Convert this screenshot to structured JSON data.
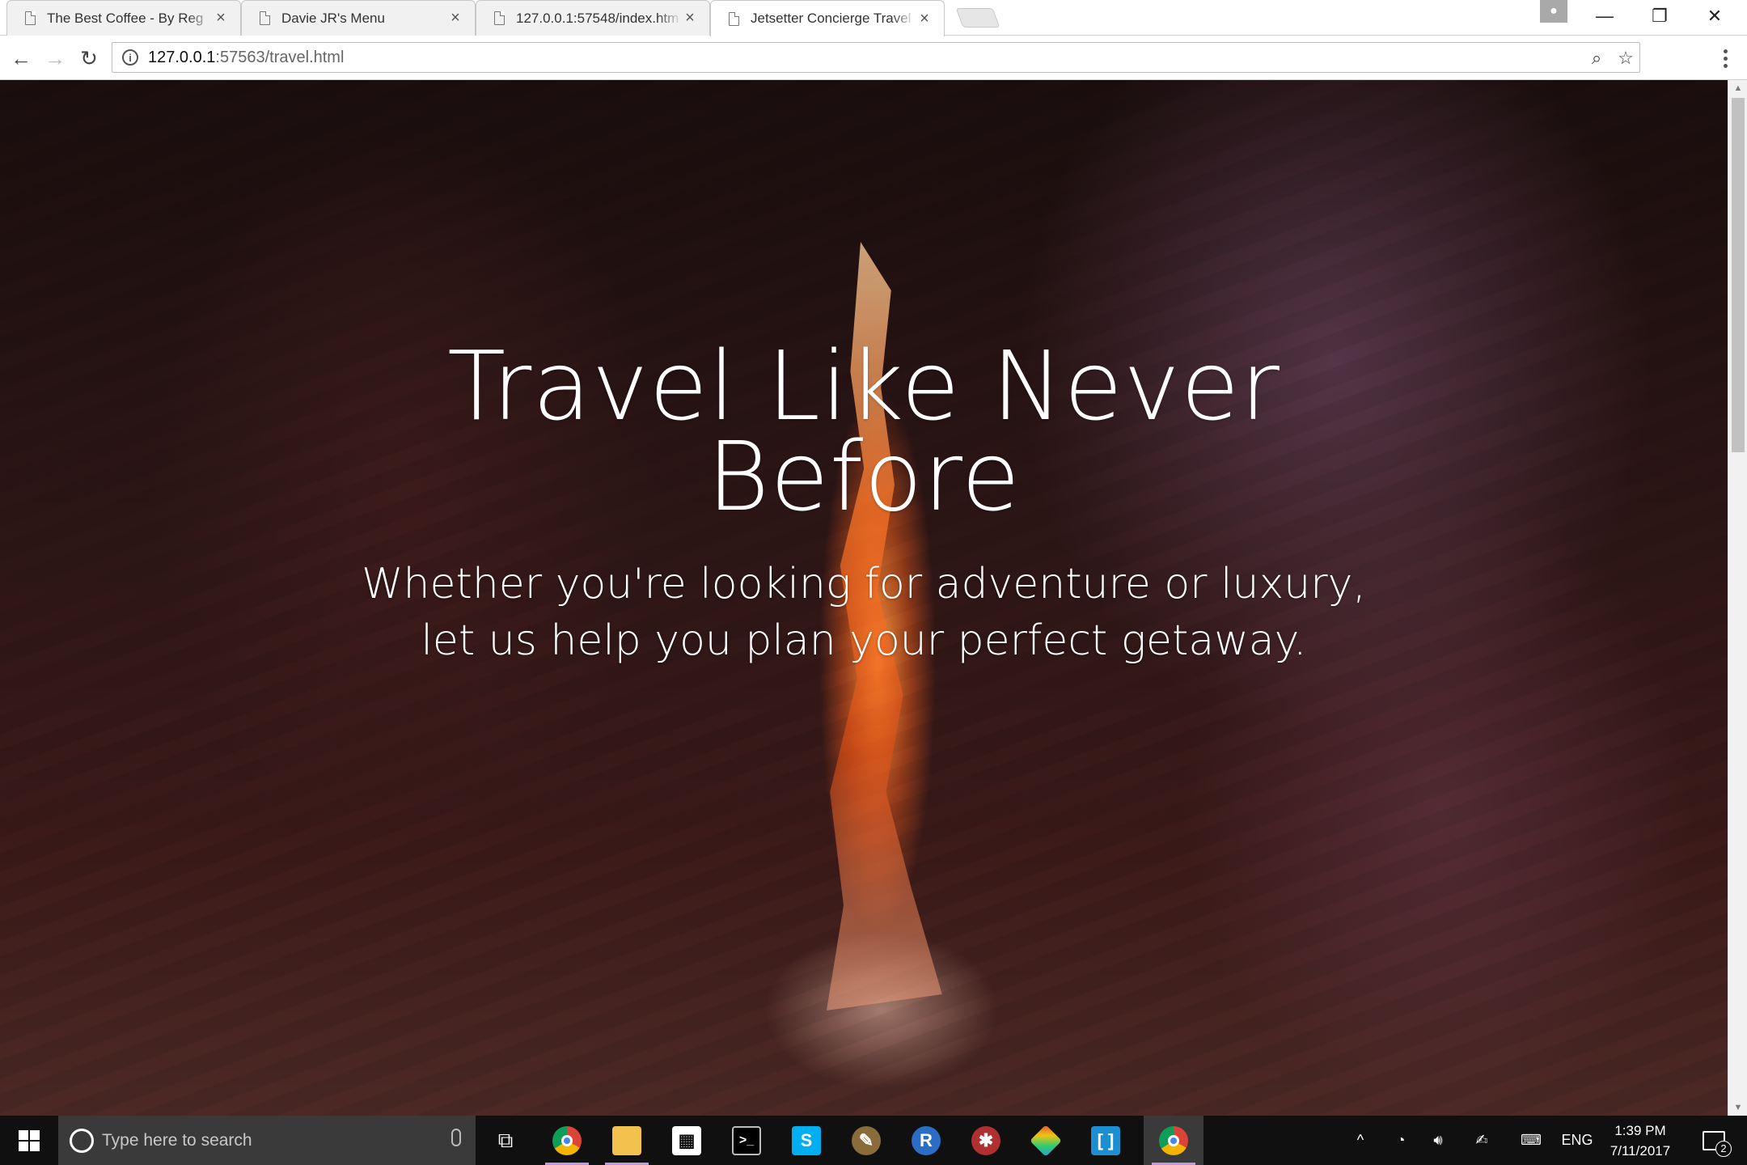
{
  "browser": {
    "tabs": [
      {
        "title": "The Best Coffee - By Reg",
        "active": false
      },
      {
        "title": "Davie JR's Menu",
        "active": false
      },
      {
        "title": "127.0.0.1:57548/index.htm",
        "active": false
      },
      {
        "title": "Jetsetter Concierge Travel",
        "active": true
      }
    ],
    "address": {
      "host": "127.0.0.1",
      "rest": ":57563/travel.html"
    }
  },
  "page": {
    "hero_title": "Travel Like Never Before",
    "hero_subtitle": "Whether you're looking for adventure or luxury, let us help you plan your perfect getaway."
  },
  "taskbar": {
    "search_placeholder": "Type here to search",
    "apps": [
      "chrome-icon",
      "file-explorer-icon",
      "store-icon",
      "terminal-icon",
      "skype-icon",
      "gimp-icon",
      "r-icon",
      "spider-icon",
      "git-icon",
      "brackets-icon",
      "chrome-icon"
    ],
    "language": "ENG",
    "time": "1:39 PM",
    "date": "7/11/2017",
    "notification_count": "2"
  },
  "colors": {
    "taskbar": "#101010",
    "search_box": "#3a3a3a",
    "running_indicator": "#c09ad8",
    "hero_text": "#ffffff"
  }
}
